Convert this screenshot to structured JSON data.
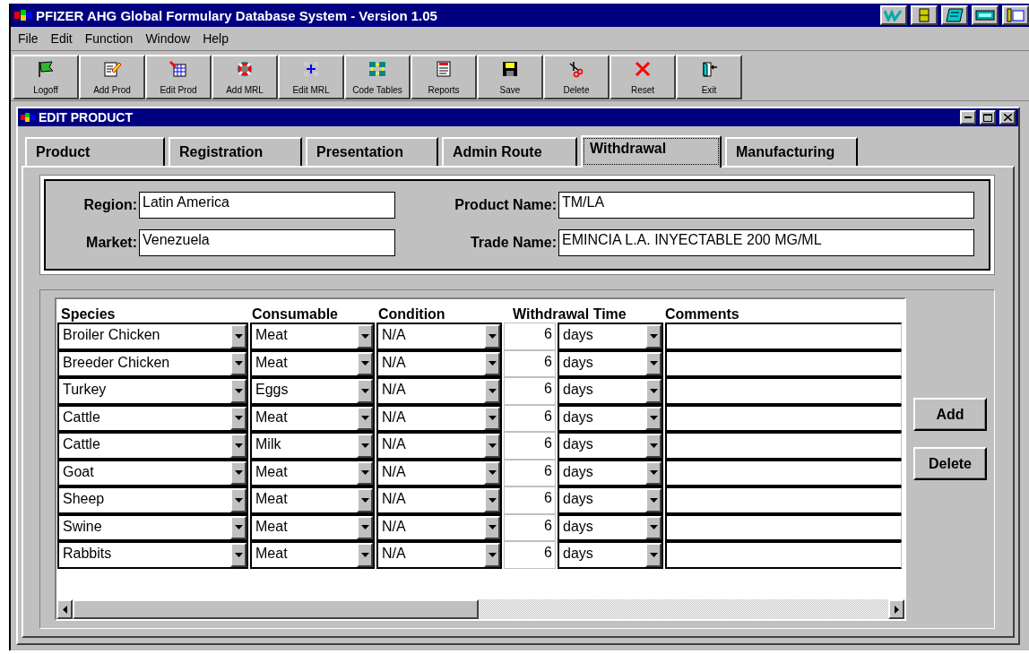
{
  "window": {
    "title": "PFIZER AHG Global Formulary Database System - Version 1.05"
  },
  "menu": [
    {
      "label": "File"
    },
    {
      "label": "Edit"
    },
    {
      "label": "Function"
    },
    {
      "label": "Window"
    },
    {
      "label": "Help"
    }
  ],
  "toolbar": [
    {
      "label": "Logoff",
      "kind": "logoff"
    },
    {
      "label": "Add Prod",
      "kind": "add_prod"
    },
    {
      "label": "Edit Prod",
      "kind": "edit_prod"
    },
    {
      "label": "Add MRL",
      "kind": "add_mrl"
    },
    {
      "label": "Edit MRL",
      "kind": "edit_mrl"
    },
    {
      "label": "Code Tables",
      "kind": "code_tables"
    },
    {
      "label": "Reports",
      "kind": "reports"
    },
    {
      "label": "Save",
      "kind": "save"
    },
    {
      "label": "Delete",
      "kind": "delete"
    },
    {
      "label": "Reset",
      "kind": "reset"
    },
    {
      "label": "Exit",
      "kind": "exit"
    }
  ],
  "child_window": {
    "title": "EDIT PRODUCT"
  },
  "tabs": [
    {
      "label": "Product",
      "selected": false
    },
    {
      "label": "Registration",
      "selected": false
    },
    {
      "label": "Presentation",
      "selected": false
    },
    {
      "label": "Admin Route",
      "selected": false
    },
    {
      "label": "Withdrawal",
      "selected": true
    },
    {
      "label": "Manufacturing",
      "selected": false
    }
  ],
  "header_fields": [
    {
      "label": "Region:",
      "value": "Latin America"
    },
    {
      "label": "Product Name:",
      "value": "TM/LA"
    },
    {
      "label": "Market:",
      "value": "Venezuela"
    },
    {
      "label": "Trade Name:",
      "value": "EMINCIA L.A. INYECTABLE 200 MG/ML"
    }
  ],
  "grid": {
    "columns": [
      "Species",
      "Consumable",
      "Condition",
      "Withdrawal Time",
      "Comments"
    ],
    "rows": [
      {
        "species": "Broiler Chicken",
        "consumable": "Meat",
        "condition": "N/A",
        "time": "6",
        "unit": "days"
      },
      {
        "species": "Breeder Chicken",
        "consumable": "Meat",
        "condition": "N/A",
        "time": "6",
        "unit": "days"
      },
      {
        "species": "Turkey",
        "consumable": "Eggs",
        "condition": "N/A",
        "time": "6",
        "unit": "days"
      },
      {
        "species": "Cattle",
        "consumable": "Meat",
        "condition": "N/A",
        "time": "6",
        "unit": "days"
      },
      {
        "species": "Cattle",
        "consumable": "Milk",
        "condition": "N/A",
        "time": "6",
        "unit": "days"
      },
      {
        "species": "Goat",
        "consumable": "Meat",
        "condition": "N/A",
        "time": "6",
        "unit": "days"
      },
      {
        "species": "Sheep",
        "consumable": "Meat",
        "condition": "N/A",
        "time": "6",
        "unit": "days"
      },
      {
        "species": "Swine",
        "consumable": "Meat",
        "condition": "N/A",
        "time": "6",
        "unit": "days"
      },
      {
        "species": "Rabbits",
        "consumable": "Meat",
        "condition": "N/A",
        "time": "6",
        "unit": "days"
      }
    ]
  },
  "buttons": [
    {
      "label": "Add"
    },
    {
      "label": "Delete"
    }
  ]
}
